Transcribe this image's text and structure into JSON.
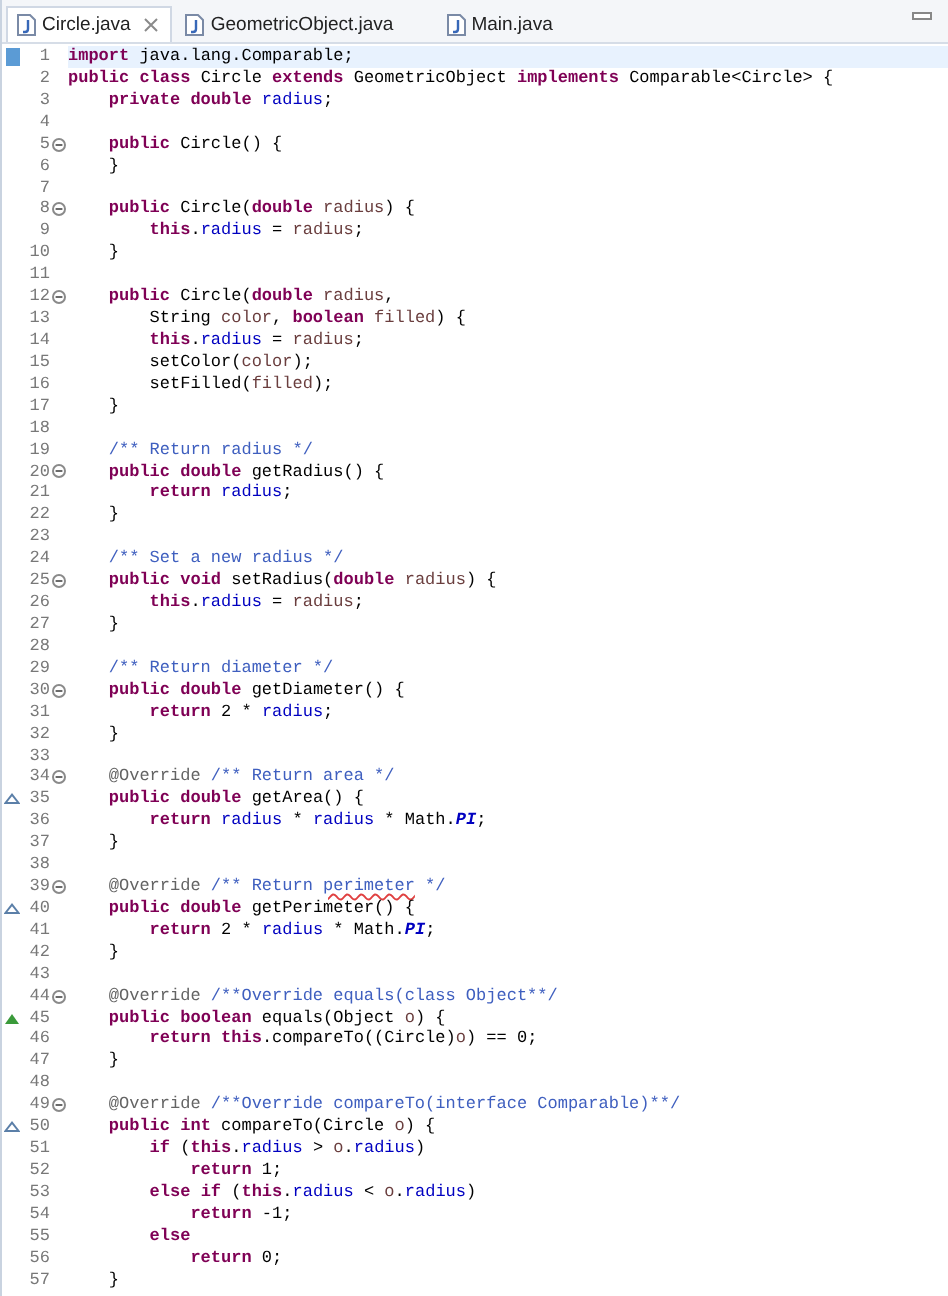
{
  "tabs": [
    {
      "label": "Circle.java",
      "selected": true,
      "closable": true
    },
    {
      "label": "GeometricObject.java",
      "selected": false,
      "closable": false
    },
    {
      "label": "Main.java",
      "selected": false,
      "closable": false
    }
  ],
  "lines": [
    {
      "number": "1",
      "kind": "plain",
      "fold": false,
      "current": true,
      "segments": [
        {
          "kind": "keyword",
          "text": "import"
        },
        {
          "kind": "plain",
          "text": " java.lang.Comparable;"
        }
      ]
    },
    {
      "number": "2",
      "kind": "plain",
      "fold": false,
      "current": false,
      "segments": [
        {
          "kind": "keyword",
          "text": "public"
        },
        {
          "kind": "keyword",
          "text": " class"
        },
        {
          "kind": "plain",
          "text": " Circle "
        },
        {
          "kind": "keyword",
          "text": "extends"
        },
        {
          "kind": "plain",
          "text": " GeometricObject "
        },
        {
          "kind": "keyword",
          "text": "implements"
        },
        {
          "kind": "plain",
          "text": " Comparable<Circle> {"
        }
      ]
    },
    {
      "number": "3",
      "kind": "plain",
      "fold": false,
      "current": false,
      "segments": [
        {
          "kind": "keyword",
          "text": "    private"
        },
        {
          "kind": "keyword",
          "text": " double"
        },
        {
          "kind": "field",
          "text": " radius"
        },
        {
          "kind": "plain",
          "text": ";"
        }
      ]
    },
    {
      "number": "4",
      "kind": "plain",
      "fold": false,
      "current": false
    },
    {
      "number": "5",
      "kind": "plain",
      "fold": true,
      "current": false,
      "segments": [
        {
          "kind": "keyword",
          "text": "    public"
        },
        {
          "kind": "plain",
          "text": " Circle() {"
        }
      ]
    },
    {
      "number": "6",
      "kind": "plain",
      "fold": false,
      "current": false,
      "segments": [
        {
          "kind": "plain",
          "text": "    }"
        }
      ]
    },
    {
      "number": "7",
      "kind": "plain",
      "fold": false,
      "current": false
    },
    {
      "number": "8",
      "kind": "plain",
      "fold": true,
      "current": false,
      "segments": [
        {
          "kind": "keyword",
          "text": "    public"
        },
        {
          "kind": "plain",
          "text": " Circle("
        },
        {
          "kind": "keyword",
          "text": "double"
        },
        {
          "kind": "variable",
          "text": " radius"
        },
        {
          "kind": "plain",
          "text": ") {"
        }
      ]
    },
    {
      "number": "9",
      "kind": "plain",
      "fold": false,
      "current": false,
      "segments": [
        {
          "kind": "keyword",
          "text": "        this"
        },
        {
          "kind": "plain",
          "text": "."
        },
        {
          "kind": "field",
          "text": "radius"
        },
        {
          "kind": "plain",
          "text": " = "
        },
        {
          "kind": "variable",
          "text": "radius"
        },
        {
          "kind": "plain",
          "text": ";"
        }
      ]
    },
    {
      "number": "10",
      "kind": "plain",
      "fold": false,
      "current": false,
      "segments": [
        {
          "kind": "plain",
          "text": "    }"
        }
      ]
    },
    {
      "number": "11",
      "kind": "plain",
      "fold": false,
      "current": false
    },
    {
      "number": "12",
      "kind": "plain",
      "fold": true,
      "current": false,
      "segments": [
        {
          "kind": "keyword",
          "text": "    public"
        },
        {
          "kind": "plain",
          "text": " Circle("
        },
        {
          "kind": "keyword",
          "text": "double"
        },
        {
          "kind": "variable",
          "text": " radius"
        },
        {
          "kind": "plain",
          "text": ","
        }
      ]
    },
    {
      "number": "13",
      "kind": "plain",
      "fold": false,
      "current": false,
      "segments": [
        {
          "kind": "plain",
          "text": "        String "
        },
        {
          "kind": "variable",
          "text": "color"
        },
        {
          "kind": "plain",
          "text": ", "
        },
        {
          "kind": "keyword",
          "text": "boolean"
        },
        {
          "kind": "variable",
          "text": " filled"
        },
        {
          "kind": "plain",
          "text": ") {"
        }
      ]
    },
    {
      "number": "14",
      "kind": "plain",
      "fold": false,
      "current": false,
      "segments": [
        {
          "kind": "keyword",
          "text": "        this"
        },
        {
          "kind": "plain",
          "text": "."
        },
        {
          "kind": "field",
          "text": "radius"
        },
        {
          "kind": "plain",
          "text": " = "
        },
        {
          "kind": "variable",
          "text": "radius"
        },
        {
          "kind": "plain",
          "text": ";"
        }
      ]
    },
    {
      "number": "15",
      "kind": "plain",
      "fold": false,
      "current": false,
      "segments": [
        {
          "kind": "plain",
          "text": "        setColor("
        },
        {
          "kind": "variable",
          "text": "color"
        },
        {
          "kind": "plain",
          "text": ");"
        }
      ]
    },
    {
      "number": "16",
      "kind": "plain",
      "fold": false,
      "current": false,
      "segments": [
        {
          "kind": "plain",
          "text": "        setFilled("
        },
        {
          "kind": "variable",
          "text": "filled"
        },
        {
          "kind": "plain",
          "text": ");"
        }
      ]
    },
    {
      "number": "17",
      "kind": "plain",
      "fold": false,
      "current": false,
      "segments": [
        {
          "kind": "plain",
          "text": "    }"
        }
      ]
    },
    {
      "number": "18",
      "kind": "plain",
      "fold": false,
      "current": false
    },
    {
      "number": "19",
      "kind": "plain",
      "fold": false,
      "current": false,
      "segments": [
        {
          "kind": "comment",
          "text": "    /** Return radius */"
        }
      ]
    },
    {
      "number": "20",
      "kind": "plain",
      "fold": true,
      "current": false,
      "segments": [
        {
          "kind": "keyword",
          "text": "    public"
        },
        {
          "kind": "keyword",
          "text": " double"
        },
        {
          "kind": "plain",
          "text": " getRadius() {"
        }
      ]
    },
    {
      "number": "21",
      "kind": "plain",
      "fold": false,
      "current": false,
      "segments": [
        {
          "kind": "keyword",
          "text": "        return"
        },
        {
          "kind": "field",
          "text": " radius"
        },
        {
          "kind": "plain",
          "text": ";"
        }
      ]
    },
    {
      "number": "22",
      "kind": "plain",
      "fold": false,
      "current": false,
      "segments": [
        {
          "kind": "plain",
          "text": "    }"
        }
      ]
    },
    {
      "number": "23",
      "kind": "plain",
      "fold": false,
      "current": false
    },
    {
      "number": "24",
      "kind": "plain",
      "fold": false,
      "current": false,
      "segments": [
        {
          "kind": "comment",
          "text": "    /** Set a new radius */"
        }
      ]
    },
    {
      "number": "25",
      "kind": "plain",
      "fold": true,
      "current": false,
      "segments": [
        {
          "kind": "keyword",
          "text": "    public"
        },
        {
          "kind": "keyword",
          "text": " void"
        },
        {
          "kind": "plain",
          "text": " setRadius("
        },
        {
          "kind": "keyword",
          "text": "double"
        },
        {
          "kind": "variable",
          "text": " radius"
        },
        {
          "kind": "plain",
          "text": ") {"
        }
      ]
    },
    {
      "number": "26",
      "kind": "plain",
      "fold": false,
      "current": false,
      "segments": [
        {
          "kind": "keyword",
          "text": "        this"
        },
        {
          "kind": "plain",
          "text": "."
        },
        {
          "kind": "field",
          "text": "radius"
        },
        {
          "kind": "plain",
          "text": " = "
        },
        {
          "kind": "variable",
          "text": "radius"
        },
        {
          "kind": "plain",
          "text": ";"
        }
      ]
    },
    {
      "number": "27",
      "kind": "plain",
      "fold": false,
      "current": false,
      "segments": [
        {
          "kind": "plain",
          "text": "    }"
        }
      ]
    },
    {
      "number": "28",
      "kind": "plain",
      "fold": false,
      "current": false
    },
    {
      "number": "29",
      "kind": "plain",
      "fold": false,
      "current": false,
      "segments": [
        {
          "kind": "comment",
          "text": "    /** Return diameter */"
        }
      ]
    },
    {
      "number": "30",
      "kind": "plain",
      "fold": true,
      "current": false,
      "segments": [
        {
          "kind": "keyword",
          "text": "    public"
        },
        {
          "kind": "keyword",
          "text": " double"
        },
        {
          "kind": "plain",
          "text": " getDiameter() {"
        }
      ]
    },
    {
      "number": "31",
      "kind": "plain",
      "fold": false,
      "current": false,
      "segments": [
        {
          "kind": "keyword",
          "text": "        return"
        },
        {
          "kind": "plain",
          "text": " 2 * "
        },
        {
          "kind": "field",
          "text": "radius"
        },
        {
          "kind": "plain",
          "text": ";"
        }
      ]
    },
    {
      "number": "32",
      "kind": "plain",
      "fold": false,
      "current": false,
      "segments": [
        {
          "kind": "plain",
          "text": "    }"
        }
      ]
    },
    {
      "number": "33",
      "kind": "plain",
      "fold": false,
      "current": false
    },
    {
      "number": "34",
      "kind": "plain",
      "fold": true,
      "current": false,
      "segments": [
        {
          "kind": "annotation",
          "text": "    @Override"
        },
        {
          "kind": "comment",
          "text": " /** Return area */"
        }
      ]
    },
    {
      "number": "35",
      "kind": "implements",
      "fold": false,
      "current": false,
      "segments": [
        {
          "kind": "keyword",
          "text": "    public"
        },
        {
          "kind": "keyword",
          "text": " double"
        },
        {
          "kind": "plain",
          "text": " getArea() {"
        }
      ]
    },
    {
      "number": "36",
      "kind": "plain",
      "fold": false,
      "current": false,
      "segments": [
        {
          "kind": "keyword",
          "text": "        return"
        },
        {
          "kind": "field",
          "text": " radius"
        },
        {
          "kind": "plain",
          "text": " * "
        },
        {
          "kind": "field",
          "text": "radius"
        },
        {
          "kind": "plain",
          "text": " * Math."
        },
        {
          "kind": "constant",
          "text": "PI"
        },
        {
          "kind": "plain",
          "text": ";"
        }
      ]
    },
    {
      "number": "37",
      "kind": "plain",
      "fold": false,
      "current": false,
      "segments": [
        {
          "kind": "plain",
          "text": "    }"
        }
      ]
    },
    {
      "number": "38",
      "kind": "plain",
      "fold": false,
      "current": false
    },
    {
      "number": "39",
      "kind": "plain",
      "fold": true,
      "current": false,
      "segments": [
        {
          "kind": "annotation",
          "text": "    @Override"
        },
        {
          "kind": "comment",
          "text": " /** Return "
        },
        {
          "kind": "misspelled",
          "text": "perimeter"
        },
        {
          "kind": "comment",
          "text": " */"
        }
      ]
    },
    {
      "number": "40",
      "kind": "implements",
      "fold": false,
      "current": false,
      "segments": [
        {
          "kind": "keyword",
          "text": "    public"
        },
        {
          "kind": "keyword",
          "text": " double"
        },
        {
          "kind": "plain",
          "text": " getPerimeter() {"
        }
      ]
    },
    {
      "number": "41",
      "kind": "plain",
      "fold": false,
      "current": false,
      "segments": [
        {
          "kind": "keyword",
          "text": "        return"
        },
        {
          "kind": "plain",
          "text": " 2 * "
        },
        {
          "kind": "field",
          "text": "radius"
        },
        {
          "kind": "plain",
          "text": " * Math."
        },
        {
          "kind": "constant",
          "text": "PI"
        },
        {
          "kind": "plain",
          "text": ";"
        }
      ]
    },
    {
      "number": "42",
      "kind": "plain",
      "fold": false,
      "current": false,
      "segments": [
        {
          "kind": "plain",
          "text": "    }"
        }
      ]
    },
    {
      "number": "43",
      "kind": "plain",
      "fold": false,
      "current": false
    },
    {
      "number": "44",
      "kind": "plain",
      "fold": true,
      "current": false,
      "segments": [
        {
          "kind": "annotation",
          "text": "    @Override"
        },
        {
          "kind": "comment",
          "text": " /**Override equals(class Object**/"
        }
      ]
    },
    {
      "number": "45",
      "kind": "overrides",
      "fold": false,
      "current": false,
      "segments": [
        {
          "kind": "keyword",
          "text": "    public"
        },
        {
          "kind": "keyword",
          "text": " boolean"
        },
        {
          "kind": "plain",
          "text": " equals(Object "
        },
        {
          "kind": "variable",
          "text": "o"
        },
        {
          "kind": "plain",
          "text": ") {"
        }
      ]
    },
    {
      "number": "46",
      "kind": "plain",
      "fold": false,
      "current": false,
      "segments": [
        {
          "kind": "keyword",
          "text": "        return"
        },
        {
          "kind": "keyword",
          "text": " this"
        },
        {
          "kind": "plain",
          "text": ".compareTo((Circle)"
        },
        {
          "kind": "variable",
          "text": "o"
        },
        {
          "kind": "plain",
          "text": ") == 0;"
        }
      ]
    },
    {
      "number": "47",
      "kind": "plain",
      "fold": false,
      "current": false,
      "segments": [
        {
          "kind": "plain",
          "text": "    }"
        }
      ]
    },
    {
      "number": "48",
      "kind": "plain",
      "fold": false,
      "current": false
    },
    {
      "number": "49",
      "kind": "plain",
      "fold": true,
      "current": false,
      "segments": [
        {
          "kind": "annotation",
          "text": "    @Override"
        },
        {
          "kind": "comment",
          "text": " /**Override compareTo(interface Comparable)**/"
        }
      ]
    },
    {
      "number": "50",
      "kind": "implements",
      "fold": false,
      "current": false,
      "segments": [
        {
          "kind": "keyword",
          "text": "    public"
        },
        {
          "kind": "keyword",
          "text": " int"
        },
        {
          "kind": "plain",
          "text": " compareTo(Circle "
        },
        {
          "kind": "variable",
          "text": "o"
        },
        {
          "kind": "plain",
          "text": ") {"
        }
      ]
    },
    {
      "number": "51",
      "kind": "plain",
      "fold": false,
      "current": false,
      "segments": [
        {
          "kind": "keyword",
          "text": "        if"
        },
        {
          "kind": "plain",
          "text": " ("
        },
        {
          "kind": "keyword",
          "text": "this"
        },
        {
          "kind": "plain",
          "text": "."
        },
        {
          "kind": "field",
          "text": "radius"
        },
        {
          "kind": "plain",
          "text": " > "
        },
        {
          "kind": "variable",
          "text": "o"
        },
        {
          "kind": "plain",
          "text": "."
        },
        {
          "kind": "field",
          "text": "radius"
        },
        {
          "kind": "plain",
          "text": ")"
        }
      ]
    },
    {
      "number": "52",
      "kind": "plain",
      "fold": false,
      "current": false,
      "segments": [
        {
          "kind": "keyword",
          "text": "            return"
        },
        {
          "kind": "plain",
          "text": " 1;"
        }
      ]
    },
    {
      "number": "53",
      "kind": "plain",
      "fold": false,
      "current": false,
      "segments": [
        {
          "kind": "keyword",
          "text": "        else"
        },
        {
          "kind": "keyword",
          "text": " if"
        },
        {
          "kind": "plain",
          "text": " ("
        },
        {
          "kind": "keyword",
          "text": "this"
        },
        {
          "kind": "plain",
          "text": "."
        },
        {
          "kind": "field",
          "text": "radius"
        },
        {
          "kind": "plain",
          "text": " < "
        },
        {
          "kind": "variable",
          "text": "o"
        },
        {
          "kind": "plain",
          "text": "."
        },
        {
          "kind": "field",
          "text": "radius"
        },
        {
          "kind": "plain",
          "text": ")"
        }
      ]
    },
    {
      "number": "54",
      "kind": "plain",
      "fold": false,
      "current": false,
      "segments": [
        {
          "kind": "keyword",
          "text": "            return"
        },
        {
          "kind": "plain",
          "text": " -1;"
        }
      ]
    },
    {
      "number": "55",
      "kind": "plain",
      "fold": false,
      "current": false,
      "segments": [
        {
          "kind": "keyword",
          "text": "        else"
        }
      ]
    },
    {
      "number": "56",
      "kind": "plain",
      "fold": false,
      "current": false,
      "segments": [
        {
          "kind": "keyword",
          "text": "            return"
        },
        {
          "kind": "plain",
          "text": " 0;"
        }
      ]
    },
    {
      "number": "57",
      "kind": "plain",
      "fold": false,
      "current": false,
      "segments": [
        {
          "kind": "plain",
          "text": "    }"
        }
      ]
    }
  ]
}
